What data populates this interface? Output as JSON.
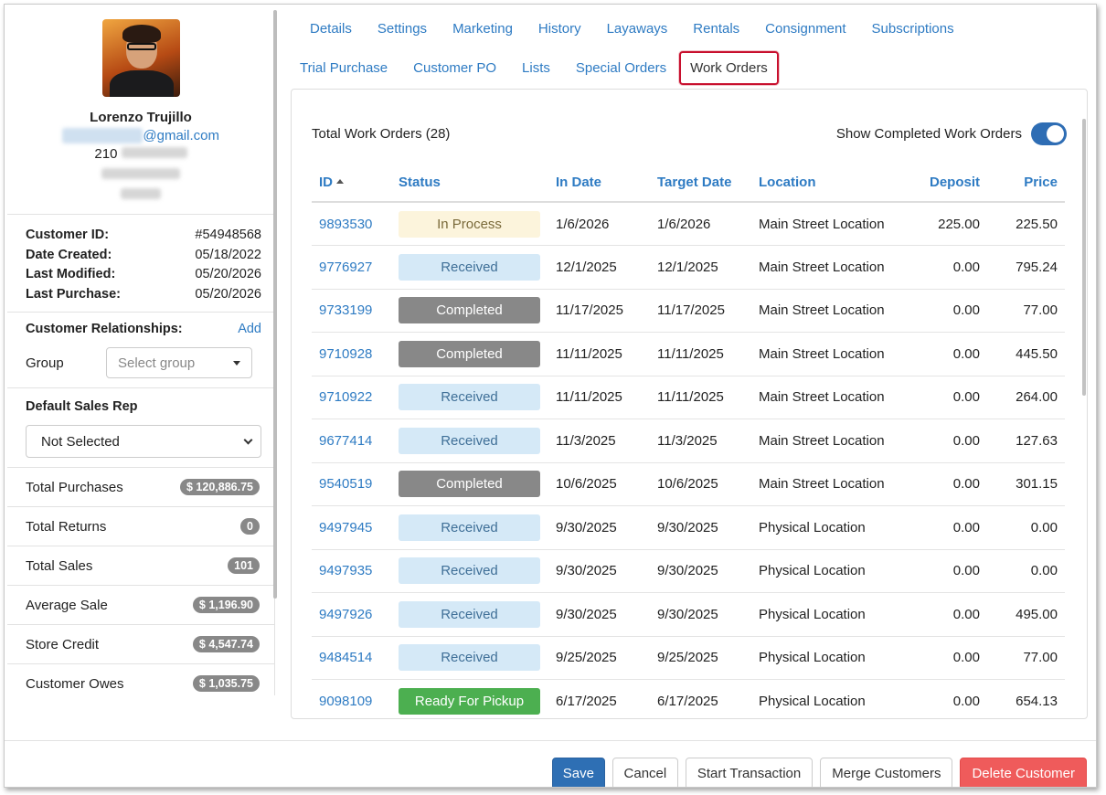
{
  "customer": {
    "name": "Lorenzo Trujillo",
    "email_suffix": "@gmail.com",
    "phone_prefix": "210",
    "meta": [
      {
        "label": "Customer ID:",
        "value": "#54948568"
      },
      {
        "label": "Date Created:",
        "value": "05/18/2022"
      },
      {
        "label": "Last Modified:",
        "value": "05/20/2026"
      },
      {
        "label": "Last Purchase:",
        "value": "05/20/2026"
      }
    ],
    "relationships_label": "Customer Relationships:",
    "add_label": "Add",
    "group_label": "Group",
    "group_placeholder": "Select group",
    "sales_rep_label": "Default Sales Rep",
    "sales_rep_value": "Not Selected",
    "stats": [
      {
        "label": "Total Purchases",
        "value": "$ 120,886.75"
      },
      {
        "label": "Total Returns",
        "value": "0"
      },
      {
        "label": "Total Sales",
        "value": "101"
      },
      {
        "label": "Average Sale",
        "value": "$ 1,196.90"
      },
      {
        "label": "Store Credit",
        "value": "$ 4,547.74"
      },
      {
        "label": "Customer Owes",
        "value": "$ 1,035.75"
      }
    ]
  },
  "tabs": {
    "row1": [
      "Details",
      "Settings",
      "Marketing",
      "History",
      "Layaways",
      "Rentals",
      "Consignment",
      "Subscriptions"
    ],
    "row2": [
      "Trial Purchase",
      "Customer PO",
      "Lists",
      "Special Orders",
      "Work Orders"
    ],
    "active": "Work Orders"
  },
  "work_orders": {
    "total_label": "Total Work Orders (28)",
    "toggle_label": "Show Completed Work Orders",
    "toggle_on": true,
    "columns": [
      "ID",
      "Status",
      "In Date",
      "Target Date",
      "Location",
      "Deposit",
      "Price"
    ],
    "rows": [
      {
        "id": "9893530",
        "status": "In Process",
        "in_date": "1/6/2026",
        "target_date": "1/6/2026",
        "location": "Main Street Location",
        "deposit": "225.00",
        "price": "225.50"
      },
      {
        "id": "9776927",
        "status": "Received",
        "in_date": "12/1/2025",
        "target_date": "12/1/2025",
        "location": "Main Street Location",
        "deposit": "0.00",
        "price": "795.24"
      },
      {
        "id": "9733199",
        "status": "Completed",
        "in_date": "11/17/2025",
        "target_date": "11/17/2025",
        "location": "Main Street Location",
        "deposit": "0.00",
        "price": "77.00"
      },
      {
        "id": "9710928",
        "status": "Completed",
        "in_date": "11/11/2025",
        "target_date": "11/11/2025",
        "location": "Main Street Location",
        "deposit": "0.00",
        "price": "445.50"
      },
      {
        "id": "9710922",
        "status": "Received",
        "in_date": "11/11/2025",
        "target_date": "11/11/2025",
        "location": "Main Street Location",
        "deposit": "0.00",
        "price": "264.00"
      },
      {
        "id": "9677414",
        "status": "Received",
        "in_date": "11/3/2025",
        "target_date": "11/3/2025",
        "location": "Main Street Location",
        "deposit": "0.00",
        "price": "127.63"
      },
      {
        "id": "9540519",
        "status": "Completed",
        "in_date": "10/6/2025",
        "target_date": "10/6/2025",
        "location": "Main Street Location",
        "deposit": "0.00",
        "price": "301.15"
      },
      {
        "id": "9497945",
        "status": "Received",
        "in_date": "9/30/2025",
        "target_date": "9/30/2025",
        "location": "Physical Location",
        "deposit": "0.00",
        "price": "0.00"
      },
      {
        "id": "9497935",
        "status": "Received",
        "in_date": "9/30/2025",
        "target_date": "9/30/2025",
        "location": "Physical Location",
        "deposit": "0.00",
        "price": "0.00"
      },
      {
        "id": "9497926",
        "status": "Received",
        "in_date": "9/30/2025",
        "target_date": "9/30/2025",
        "location": "Physical Location",
        "deposit": "0.00",
        "price": "495.00"
      },
      {
        "id": "9484514",
        "status": "Received",
        "in_date": "9/25/2025",
        "target_date": "9/25/2025",
        "location": "Physical Location",
        "deposit": "0.00",
        "price": "77.00"
      },
      {
        "id": "9098109",
        "status": "Ready For Pickup",
        "in_date": "6/17/2025",
        "target_date": "6/17/2025",
        "location": "Physical Location",
        "deposit": "0.00",
        "price": "654.13"
      }
    ]
  },
  "footer": {
    "save": "Save",
    "cancel": "Cancel",
    "start_transaction": "Start Transaction",
    "merge": "Merge Customers",
    "delete": "Delete Customer"
  },
  "colors": {
    "link": "#2e7bc3",
    "active_tab_border": "#c8102e",
    "save_button": "#2e6fb4",
    "delete_button": "#ef5b5b",
    "in_process": "#fcf4dc",
    "received": "#d5e9f7",
    "completed": "#888888",
    "ready": "#4caf50"
  }
}
